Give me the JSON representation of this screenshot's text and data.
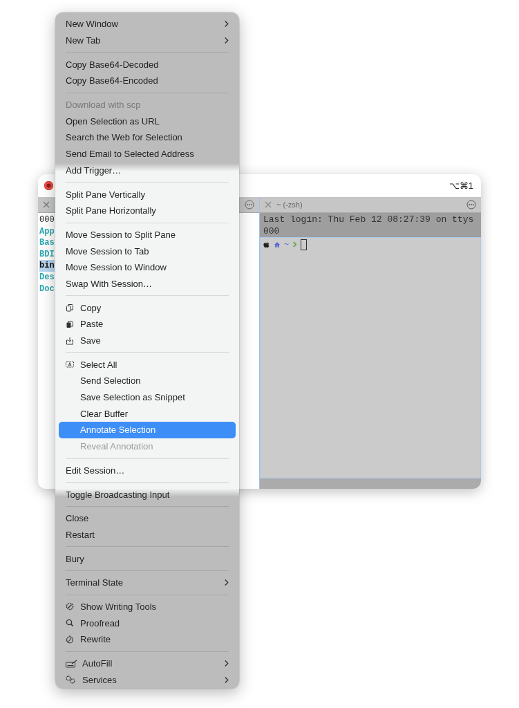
{
  "window": {
    "shortcut": "⌥⌘1",
    "close_button": true
  },
  "left_pane": {
    "lines": [
      {
        "text": "000",
        "kind": "plain"
      },
      {
        "text": "App",
        "kind": "dir"
      },
      {
        "text": "Bas",
        "kind": "dir"
      },
      {
        "text": "BDI",
        "kind": "dir"
      },
      {
        "text": "bin",
        "kind": "highlight"
      },
      {
        "text": "Des",
        "kind": "dir"
      },
      {
        "text": "Doc",
        "kind": "dir"
      }
    ]
  },
  "right_pane": {
    "tab_title": "~ (-zsh)",
    "output": "Last login: Thu Feb 12 08:27:39 on ttys000",
    "prompt_dir": "~"
  },
  "menu": {
    "sections": [
      [
        {
          "label": "New Window",
          "kind": "submenu",
          "disabled": false,
          "selected": false
        },
        {
          "label": "New Tab",
          "kind": "submenu",
          "disabled": false,
          "selected": false
        }
      ],
      [
        {
          "label": "Copy Base64-Decoded",
          "kind": "plain",
          "disabled": false,
          "selected": false
        },
        {
          "label": "Copy Base64-Encoded",
          "kind": "plain",
          "disabled": false,
          "selected": false
        }
      ],
      [
        {
          "label": "Download with scp",
          "kind": "plain",
          "disabled": true,
          "selected": false
        },
        {
          "label": "Open Selection as URL",
          "kind": "plain",
          "disabled": false,
          "selected": false
        },
        {
          "label": "Search the Web for Selection",
          "kind": "plain",
          "disabled": false,
          "selected": false
        },
        {
          "label": "Send Email to Selected Address",
          "kind": "plain",
          "disabled": false,
          "selected": false
        },
        {
          "label": "Add Trigger…",
          "kind": "plain",
          "disabled": false,
          "selected": false
        }
      ],
      [
        {
          "label": "Split Pane Vertically",
          "kind": "plain",
          "disabled": false,
          "selected": false
        },
        {
          "label": "Split Pane Horizontally",
          "kind": "plain",
          "disabled": false,
          "selected": false
        }
      ],
      [
        {
          "label": "Move Session to Split Pane",
          "kind": "plain",
          "disabled": false,
          "selected": false
        },
        {
          "label": "Move Session to Tab",
          "kind": "plain",
          "disabled": false,
          "selected": false
        },
        {
          "label": "Move Session to Window",
          "kind": "plain",
          "disabled": false,
          "selected": false
        },
        {
          "label": "Swap With Session…",
          "kind": "plain",
          "disabled": false,
          "selected": false
        }
      ],
      [
        {
          "label": "Copy",
          "kind": "icon",
          "disabled": false,
          "selected": false
        },
        {
          "label": "Paste",
          "kind": "icon",
          "disabled": false,
          "selected": false
        },
        {
          "label": "Save",
          "kind": "icon",
          "disabled": false,
          "selected": false
        }
      ],
      [
        {
          "label": "Select All",
          "kind": "icon",
          "disabled": false,
          "selected": false
        },
        {
          "label": "Send Selection",
          "kind": "indented",
          "disabled": false,
          "selected": false
        },
        {
          "label": "Save Selection as Snippet",
          "kind": "indented",
          "disabled": false,
          "selected": false
        },
        {
          "label": "Clear Buffer",
          "kind": "indented",
          "disabled": false,
          "selected": false
        },
        {
          "label": "Annotate Selection",
          "kind": "indented",
          "disabled": false,
          "selected": true
        },
        {
          "label": "Reveal Annotation",
          "kind": "indented",
          "disabled": true,
          "selected": false
        }
      ],
      [
        {
          "label": "Edit Session…",
          "kind": "plain",
          "disabled": false,
          "selected": false
        }
      ],
      [
        {
          "label": "Toggle Broadcasting Input",
          "kind": "plain",
          "disabled": false,
          "selected": false
        }
      ],
      [
        {
          "label": "Close",
          "kind": "plain",
          "disabled": false,
          "selected": false
        },
        {
          "label": "Restart",
          "kind": "plain",
          "disabled": false,
          "selected": false
        }
      ],
      [
        {
          "label": "Bury",
          "kind": "plain",
          "disabled": false,
          "selected": false
        }
      ],
      [
        {
          "label": "Terminal State",
          "kind": "submenu",
          "disabled": false,
          "selected": false
        }
      ],
      [
        {
          "label": "Show Writing Tools",
          "kind": "icon",
          "disabled": false,
          "selected": false
        },
        {
          "label": "Proofread",
          "kind": "icon",
          "disabled": false,
          "selected": false
        },
        {
          "label": "Rewrite",
          "kind": "icon",
          "disabled": false,
          "selected": false
        }
      ],
      [
        {
          "label": "AutoFill",
          "kind": "icon-submenu",
          "disabled": false,
          "selected": false
        },
        {
          "label": "Services",
          "kind": "icon-submenu",
          "disabled": false,
          "selected": false
        }
      ]
    ]
  }
}
